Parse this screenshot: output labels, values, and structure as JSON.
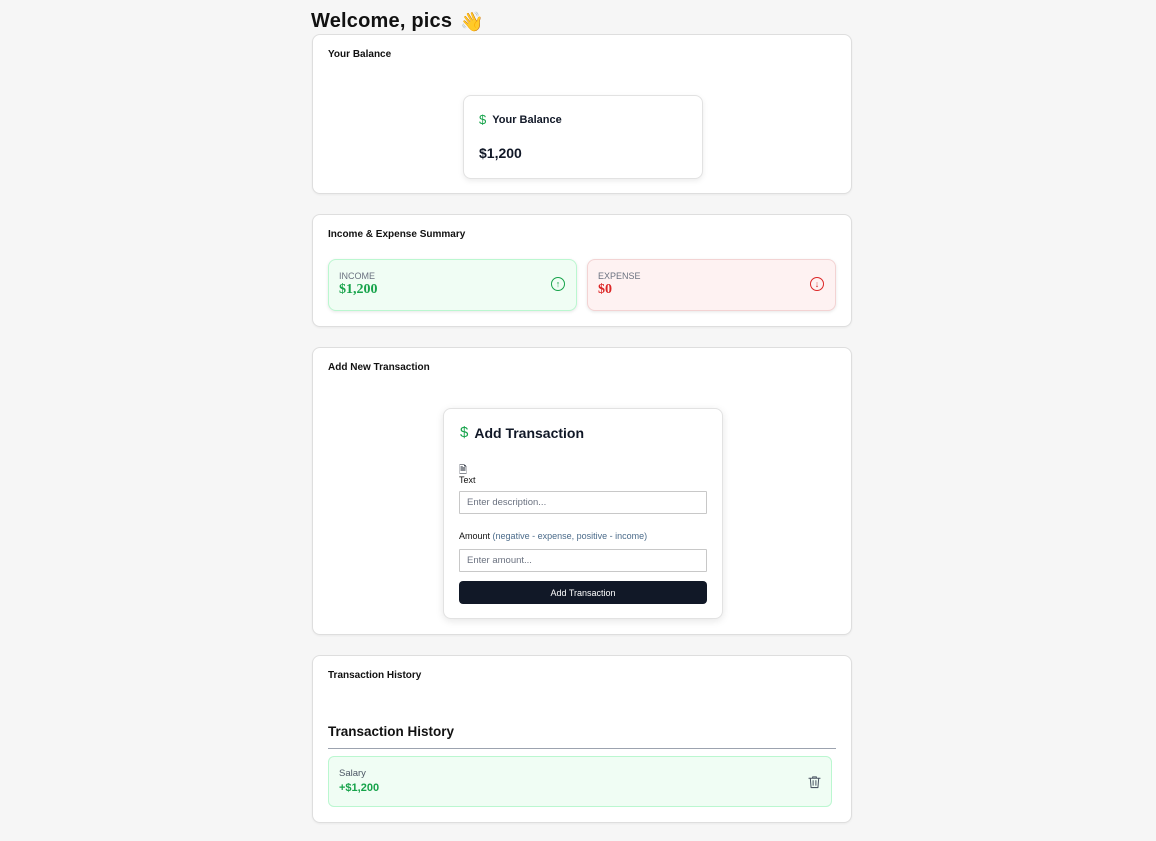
{
  "header": {
    "welcome": "Welcome, pics",
    "wave_emoji": "👋"
  },
  "balance_section": {
    "title": "Your Balance",
    "card_title": "Your Balance",
    "amount": "$1,200",
    "icon": "dollar-icon"
  },
  "summary_section": {
    "title": "Income & Expense Summary",
    "income": {
      "label": "INCOME",
      "value": "$1,200",
      "icon": "arrow-up-circle-icon"
    },
    "expense": {
      "label": "EXPENSE",
      "value": "$0",
      "icon": "arrow-down-circle-icon"
    }
  },
  "add_section": {
    "title": "Add New Transaction",
    "card_title": "Add Transaction",
    "text_label": "Text",
    "text_placeholder": "Enter description...",
    "amount_label": "Amount",
    "amount_hint": "(negative - expense, positive - income)",
    "amount_placeholder": "Enter amount...",
    "submit_label": "Add Transaction"
  },
  "history_section": {
    "title": "Transaction History",
    "heading": "Transaction History",
    "items": [
      {
        "description": "Salary",
        "amount": "+$1,200",
        "type": "income"
      }
    ]
  },
  "colors": {
    "income": "#16a34a",
    "expense": "#dc2626",
    "button": "#111827",
    "page_background": "#f6f6f6"
  }
}
